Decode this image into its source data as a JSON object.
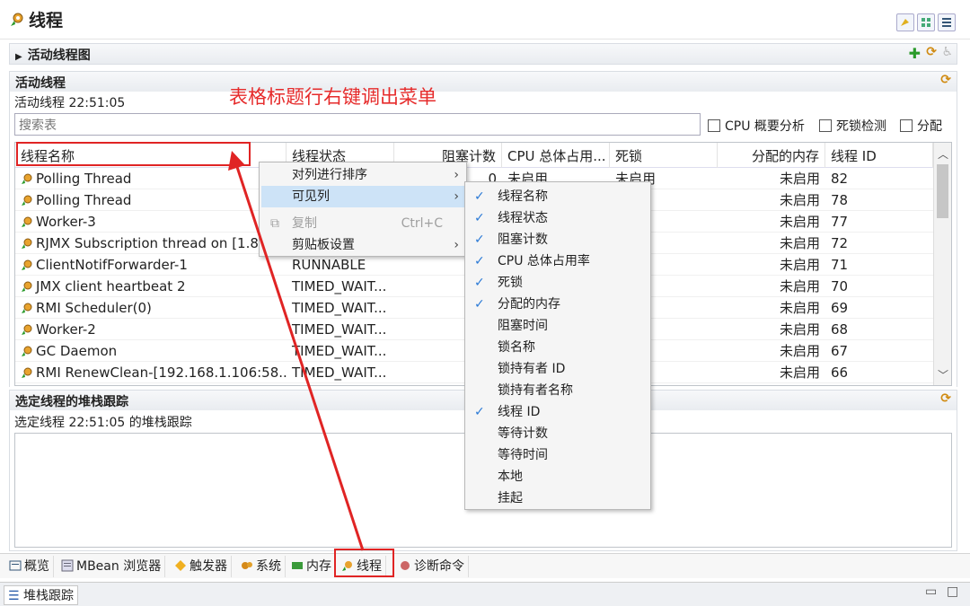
{
  "app": {
    "title": "线程"
  },
  "sections": {
    "graph_header": "活动线程图",
    "active_header": "活动线程",
    "active_time": "活动线程 22:51:05",
    "stack_header": "选定线程的堆栈跟踪",
    "stack_time": "选定线程 22:51:05 的堆栈跟踪"
  },
  "search": {
    "placeholder": "搜索表"
  },
  "options": [
    "CPU 概要分析",
    "死锁检测",
    "分配"
  ],
  "annotation": "表格标题行右键调出菜单",
  "table": {
    "columns": [
      "线程名称",
      "线程状态",
      "阻塞计数",
      "CPU 总体占用...",
      "死锁",
      "分配的内存",
      "线程 ID"
    ],
    "rows": [
      {
        "name": "Polling Thread",
        "state": "",
        "blocked": "0",
        "cpu": "未启用",
        "deadlock": "未启用",
        "alloc": "未启用",
        "id": "82"
      },
      {
        "name": "Polling Thread",
        "state": "",
        "blocked": "",
        "cpu": "",
        "deadlock": "",
        "alloc": "未启用",
        "id": "78"
      },
      {
        "name": "Worker-3",
        "state": "",
        "blocked": "",
        "cpu": "",
        "deadlock": "",
        "alloc": "未启用",
        "id": "77"
      },
      {
        "name": "RJMX Subscription thread on [1.8...",
        "state": "",
        "blocked": "",
        "cpu": "",
        "deadlock": "",
        "alloc": "未启用",
        "id": "72"
      },
      {
        "name": "ClientNotifForwarder-1",
        "state": "RUNNABLE",
        "blocked": "",
        "cpu": "",
        "deadlock": "",
        "alloc": "未启用",
        "id": "71"
      },
      {
        "name": "JMX client heartbeat 2",
        "state": "TIMED_WAIT...",
        "blocked": "",
        "cpu": "",
        "deadlock": "",
        "alloc": "未启用",
        "id": "70"
      },
      {
        "name": "RMI Scheduler(0)",
        "state": "TIMED_WAIT...",
        "blocked": "",
        "cpu": "",
        "deadlock": "",
        "alloc": "未启用",
        "id": "69"
      },
      {
        "name": "Worker-2",
        "state": "TIMED_WAIT...",
        "blocked": "",
        "cpu": "",
        "deadlock": "",
        "alloc": "未启用",
        "id": "68"
      },
      {
        "name": "GC Daemon",
        "state": "TIMED_WAIT...",
        "blocked": "",
        "cpu": "",
        "deadlock": "",
        "alloc": "未启用",
        "id": "67"
      },
      {
        "name": "RMI RenewClean-[192.168.1.106:58...",
        "state": "TIMED_WAIT...",
        "blocked": "",
        "cpu": "",
        "deadlock": "",
        "alloc": "未启用",
        "id": "66"
      }
    ]
  },
  "context_menu": {
    "items": [
      {
        "label": "对列进行排序",
        "submenu": true
      },
      {
        "label": "可见列",
        "submenu": true,
        "selected": true
      },
      {
        "label": "复制",
        "shortcut": "Ctrl+C",
        "disabled": true
      },
      {
        "label": "剪贴板设置",
        "submenu": true
      }
    ]
  },
  "visible_columns_menu": {
    "items": [
      {
        "label": "线程名称",
        "checked": true
      },
      {
        "label": "线程状态",
        "checked": true
      },
      {
        "label": "阻塞计数",
        "checked": true
      },
      {
        "label": "CPU 总体占用率",
        "checked": true
      },
      {
        "label": "死锁",
        "checked": true
      },
      {
        "label": "分配的内存",
        "checked": true
      },
      {
        "label": "阻塞时间",
        "checked": false
      },
      {
        "label": "锁名称",
        "checked": false
      },
      {
        "label": "锁持有者 ID",
        "checked": false
      },
      {
        "label": "锁持有者名称",
        "checked": false
      },
      {
        "label": "线程 ID",
        "checked": true
      },
      {
        "label": "等待计数",
        "checked": false
      },
      {
        "label": "等待时间",
        "checked": false
      },
      {
        "label": "本地",
        "checked": false
      },
      {
        "label": "挂起",
        "checked": false
      }
    ]
  },
  "tabs": [
    "概览",
    "MBean 浏览器",
    "触发器",
    "系统",
    "内存",
    "线程",
    "诊断命令"
  ],
  "bottom": {
    "stack_tab": "堆栈跟踪"
  },
  "colors": {
    "accent_red": "#e02424",
    "check_blue": "#2b7ad6",
    "selection": "#cde3f7"
  }
}
